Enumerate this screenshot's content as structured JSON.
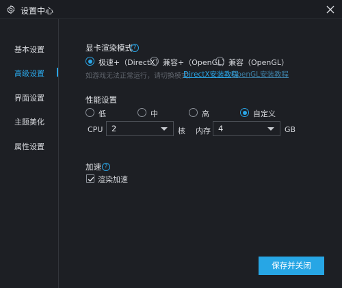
{
  "window": {
    "title": "设置中心",
    "close_icon": "close-icon",
    "gear_icon": "gear-icon"
  },
  "sidebar": {
    "items": [
      {
        "label": "基本设置",
        "active": false
      },
      {
        "label": "高级设置",
        "active": true
      },
      {
        "label": "界面设置",
        "active": false
      },
      {
        "label": "主题美化",
        "active": false
      },
      {
        "label": "属性设置",
        "active": false
      }
    ]
  },
  "render": {
    "title": "显卡渲染模式",
    "options": [
      {
        "label": "极速+（DirectX）",
        "checked": true
      },
      {
        "label": "兼容+（OpenGL）",
        "checked": false
      },
      {
        "label": "兼容（OpenGL）",
        "checked": false
      }
    ],
    "hint": "如游戏无法正常运行，请切换模式。",
    "link_directx": "DirectX安装教程",
    "link_opengl": "OpenGL安装教程"
  },
  "performance": {
    "title": "性能设置",
    "options": [
      {
        "label": "低",
        "checked": false
      },
      {
        "label": "中",
        "checked": false
      },
      {
        "label": "高",
        "checked": false
      },
      {
        "label": "自定义",
        "checked": true
      }
    ],
    "cpu_label": "CPU",
    "cpu_value": "2",
    "cpu_unit": "核",
    "mem_label": "内存",
    "mem_value": "4",
    "mem_unit": "GB"
  },
  "accel": {
    "title": "加速",
    "checkbox_label": "渲染加速",
    "checked": true
  },
  "footer": {
    "save_label": "保存并关闭"
  },
  "colors": {
    "accent": "#2aa5e6",
    "background": "#1d1f24",
    "border": "#32353b"
  }
}
